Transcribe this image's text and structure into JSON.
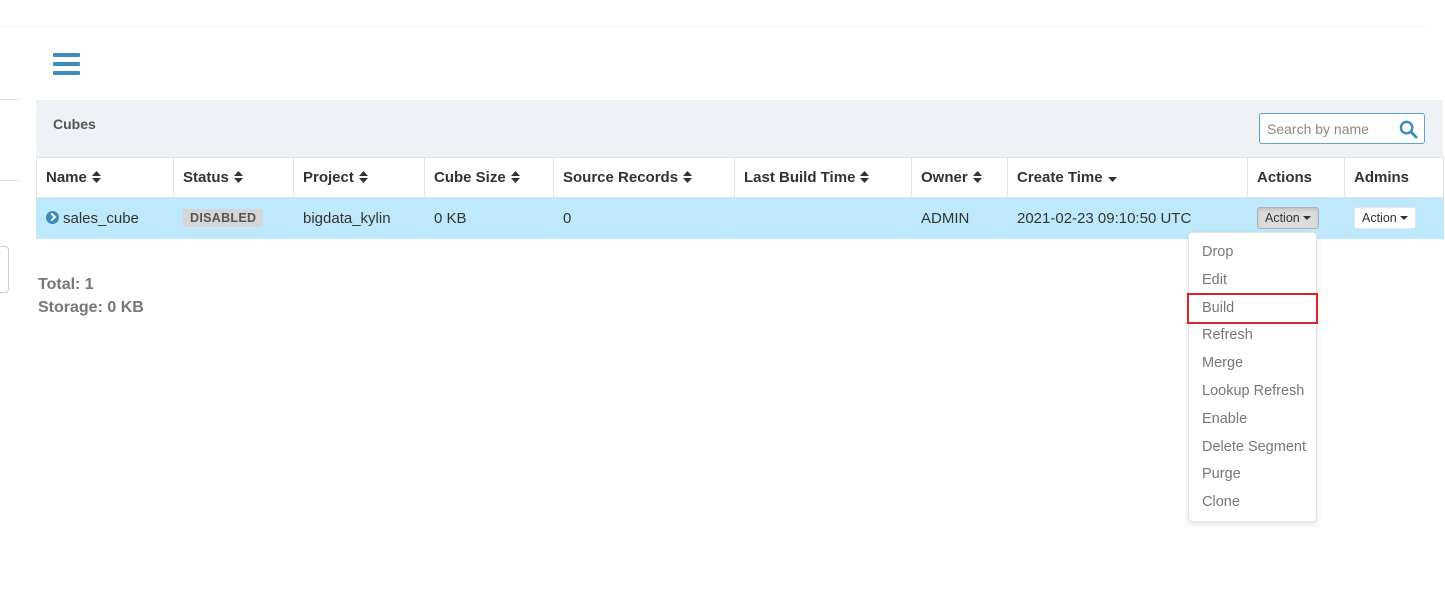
{
  "nav": {
    "menu_icon": "hamburger-menu-icon"
  },
  "panel": {
    "title": "Cubes"
  },
  "search": {
    "placeholder": "Search by name",
    "value": "",
    "icon": "search-icon"
  },
  "table": {
    "columns": [
      {
        "label": "Name",
        "sort_icon": "sort-both-icon"
      },
      {
        "label": "Status",
        "sort_icon": "sort-both-icon"
      },
      {
        "label": "Project",
        "sort_icon": "sort-both-icon"
      },
      {
        "label": "Cube Size",
        "sort_icon": "sort-both-icon"
      },
      {
        "label": "Source Records",
        "sort_icon": "sort-both-icon"
      },
      {
        "label": "Last Build Time",
        "sort_icon": "sort-both-icon"
      },
      {
        "label": "Owner",
        "sort_icon": "sort-both-icon"
      },
      {
        "label": "Create Time",
        "sort_icon": "sort-desc-icon"
      },
      {
        "label": "Actions",
        "sort_icon": ""
      },
      {
        "label": "Admins",
        "sort_icon": ""
      }
    ],
    "rows": [
      {
        "name": "sales_cube",
        "status": "DISABLED",
        "project": "bigdata_kylin",
        "cube_size": "0 KB",
        "source_records": "0",
        "last_build_time": "",
        "owner": "ADMIN",
        "create_time": "2021-02-23 09:10:50 UTC",
        "actions_label": "Action",
        "admins_label": "Action"
      }
    ]
  },
  "summary": {
    "total": "Total: 1",
    "storage": "Storage: 0 KB"
  },
  "action_menu": {
    "items": [
      "Drop",
      "Edit",
      "Build",
      "Refresh",
      "Merge",
      "Lookup Refresh",
      "Enable",
      "Delete Segment",
      "Purge",
      "Clone"
    ],
    "highlighted": "Build"
  },
  "colors": {
    "accent": "#3c8dbc",
    "row_selected": "#bee9fc",
    "panel_header": "#eef1f6",
    "highlight_border": "#d9252b",
    "badge_bg": "#d6d6d6"
  }
}
